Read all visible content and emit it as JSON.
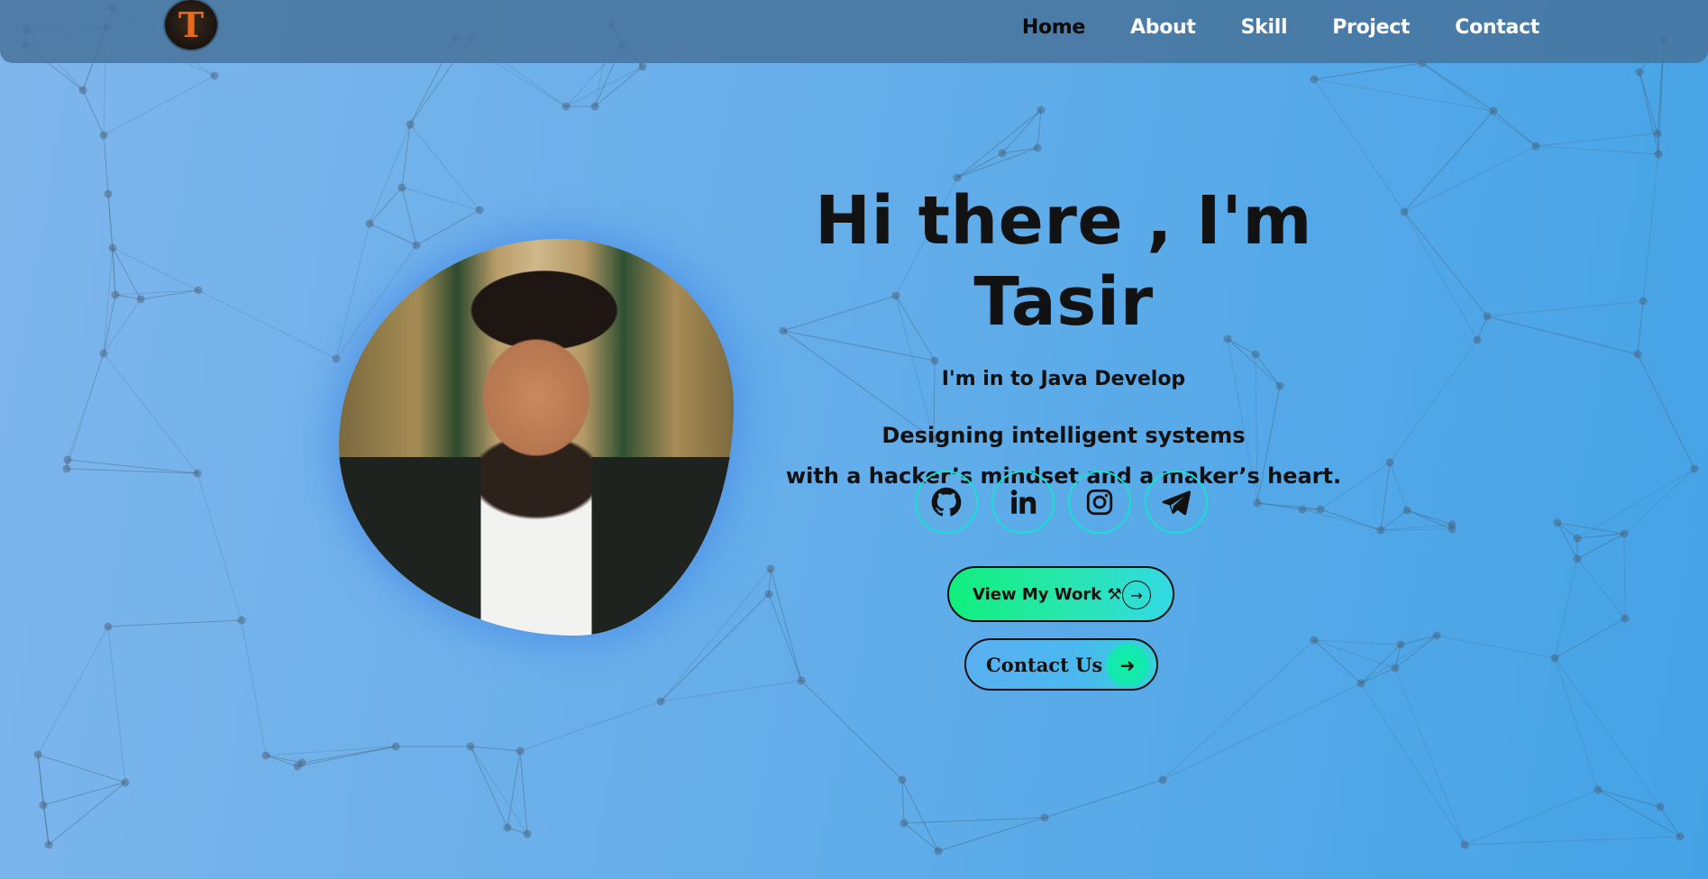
{
  "nav": {
    "logo_letter": "T",
    "links": [
      "Home",
      "About",
      "Skill",
      "Project",
      "Contact"
    ],
    "active": "Home"
  },
  "hero": {
    "title": "Hi there , I'm Tasir",
    "tagline": "I'm in to Java Develop",
    "description_line_1": "Designing intelligent systems",
    "description_line_2": "with a hacker’s mindset and a maker’s heart."
  },
  "socials": [
    "github-icon",
    "linkedin-icon",
    "instagram-icon",
    "telegram-icon"
  ],
  "buttons": {
    "view_work_label": "View My Work ⚒",
    "contact_label": "Contact Us"
  },
  "colors": {
    "accent_green": "#10ef7c",
    "accent_cyan": "#19e0d0",
    "nav_bg": "#46739b",
    "logo_orange": "#e56a1c"
  }
}
